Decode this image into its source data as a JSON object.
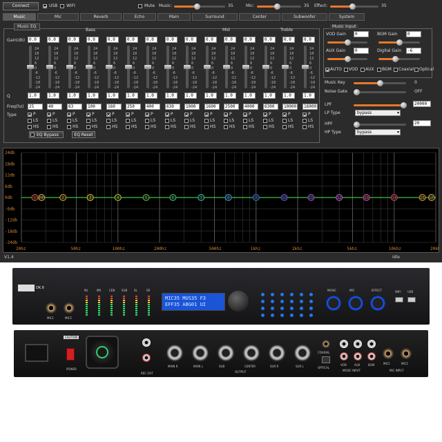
{
  "toolbar": {
    "connect": "Connect",
    "usb": "USB",
    "wifi": "WIFI",
    "mute": "Mute",
    "music_label": "Music:",
    "music_value": "35",
    "music_level": 0.45,
    "mic_label": "Mic:",
    "mic_value": "35",
    "mic_level": 0.45,
    "effect_label": "Effect:",
    "effect_value": "35",
    "effect_level": 0.45
  },
  "tabs": [
    "Music",
    "Mic",
    "Reverb",
    "Echo",
    "Main",
    "Surround",
    "Center",
    "Subwoofer",
    "System"
  ],
  "active_tab": "Music",
  "eq": {
    "group_title": "Music EQ",
    "band_sections": {
      "bass": "Bass",
      "mid": "Mid",
      "treble": "Treble"
    },
    "gain_label": "Gain(db)",
    "q_label": "Q",
    "freq_label": "Freq(hz)",
    "type_label": "Type",
    "scale": [
      "24",
      "18",
      "12",
      "6",
      "0",
      "-6",
      "-12",
      "-18",
      "-24"
    ],
    "gains": [
      "0.0",
      "0.0",
      "0.0",
      "0.0",
      "0.0",
      "0.0",
      "0.0",
      "0.0",
      "0.0",
      "0.0",
      "0.0",
      "0.0",
      "0.0",
      "0.0",
      "0.0"
    ],
    "q": [
      "1.0",
      "1.0",
      "1.0",
      "1.0",
      "1.0",
      "1.0",
      "1.0",
      "1.0",
      "1.0",
      "1.0",
      "1.0",
      "1.0",
      "1.0",
      "1.0",
      "1.0"
    ],
    "freqs": [
      "25",
      "40",
      "63",
      "100",
      "160",
      "250",
      "400",
      "630",
      "1000",
      "1600",
      "2500",
      "4000",
      "6300",
      "10000",
      "16000"
    ],
    "type_p": "P",
    "type_ls": "LS",
    "type_hs": "HS",
    "bypass": "EQ Bypass",
    "reset": "EQ Reset"
  },
  "music_input": {
    "title": "Music Input",
    "vod_gain_label": "VOD Gain",
    "vod_gain": "0",
    "bgm_gain_label": "BGM Gain",
    "bgm_gain": "0",
    "aux_gain_label": "AUX Gain",
    "aux_gain": "0",
    "digital_gain_label": "Digital Gain",
    "digital_gain": "-6",
    "sources": [
      "AUTO",
      "VOD",
      "AUX",
      "BGM",
      "Coaxial",
      "Optical"
    ],
    "music_key_label": "Music Key",
    "music_key": "0",
    "noise_gate_label": "Noise Gate",
    "noise_gate": "OFF",
    "lpf_label": "LPF",
    "lpf": "20000",
    "lp_type_label": "LP Type",
    "lp_type": "bypass",
    "hpf_label": "HPF",
    "hpf": "20",
    "hp_type_label": "HP Type",
    "hp_type": "bypass"
  },
  "graph": {
    "y_ticks": [
      "24db",
      "18db",
      "12db",
      "6db",
      "0db",
      "-6db",
      "-12db",
      "-18db",
      "-24db"
    ],
    "x_ticks": [
      "20hz",
      "50hz",
      "100hz",
      "200hz",
      "500hz",
      "1khz",
      "2khz",
      "5khz",
      "10khz",
      "20khz"
    ],
    "points": [
      "HP",
      "1",
      "2",
      "3",
      "4",
      "5",
      "6",
      "7",
      "8",
      "9",
      "10",
      "11",
      "12",
      "13",
      "14",
      "15",
      "LP"
    ],
    "point_colors": [
      "#d6b03a",
      "#e05030",
      "#e0a020",
      "#e0d020",
      "#b0d020",
      "#50c030",
      "#30c060",
      "#30c0a0",
      "#30a0e0",
      "#3070e0",
      "#6050e0",
      "#9050e0",
      "#c050d0",
      "#e040a0",
      "#e04060",
      "#e0a020",
      "#d6b03a"
    ],
    "line_color": "#3fbf3f"
  },
  "status": {
    "version": "V1.4",
    "state": "Idle"
  },
  "hardware_front": {
    "brand": "DK.6",
    "channels": [
      "ML",
      "MR",
      "CEN",
      "SUB",
      "SL",
      "SR"
    ],
    "mic_labels": [
      "MIC1",
      "MIC2"
    ],
    "lcd_line1": "MIC35 MUS35 F3",
    "lcd_line2": "EFF35 ABG01 UI",
    "knobs": [
      "MUSIC",
      "MIC",
      "EFFECT"
    ],
    "usb_labels": [
      "WIFI",
      "USB"
    ]
  },
  "hardware_back": {
    "caution": "CAUTION",
    "power": "POWER",
    "rec_out": "REC OUT",
    "outputs": [
      "MAIN R",
      "MAIN L",
      "SUB",
      "CENTER",
      "SUR R",
      "SUR L"
    ],
    "output_label": "OUTPUT",
    "digital": [
      "COAXIAL",
      "OPTICAL"
    ],
    "music_input": [
      "VOD",
      "AUX",
      "BGM"
    ],
    "music_input_label": "MUSIC INPUT",
    "mic_input": [
      "MIC1",
      "MIC2"
    ],
    "mic_input_label": "MIC INPUT"
  }
}
